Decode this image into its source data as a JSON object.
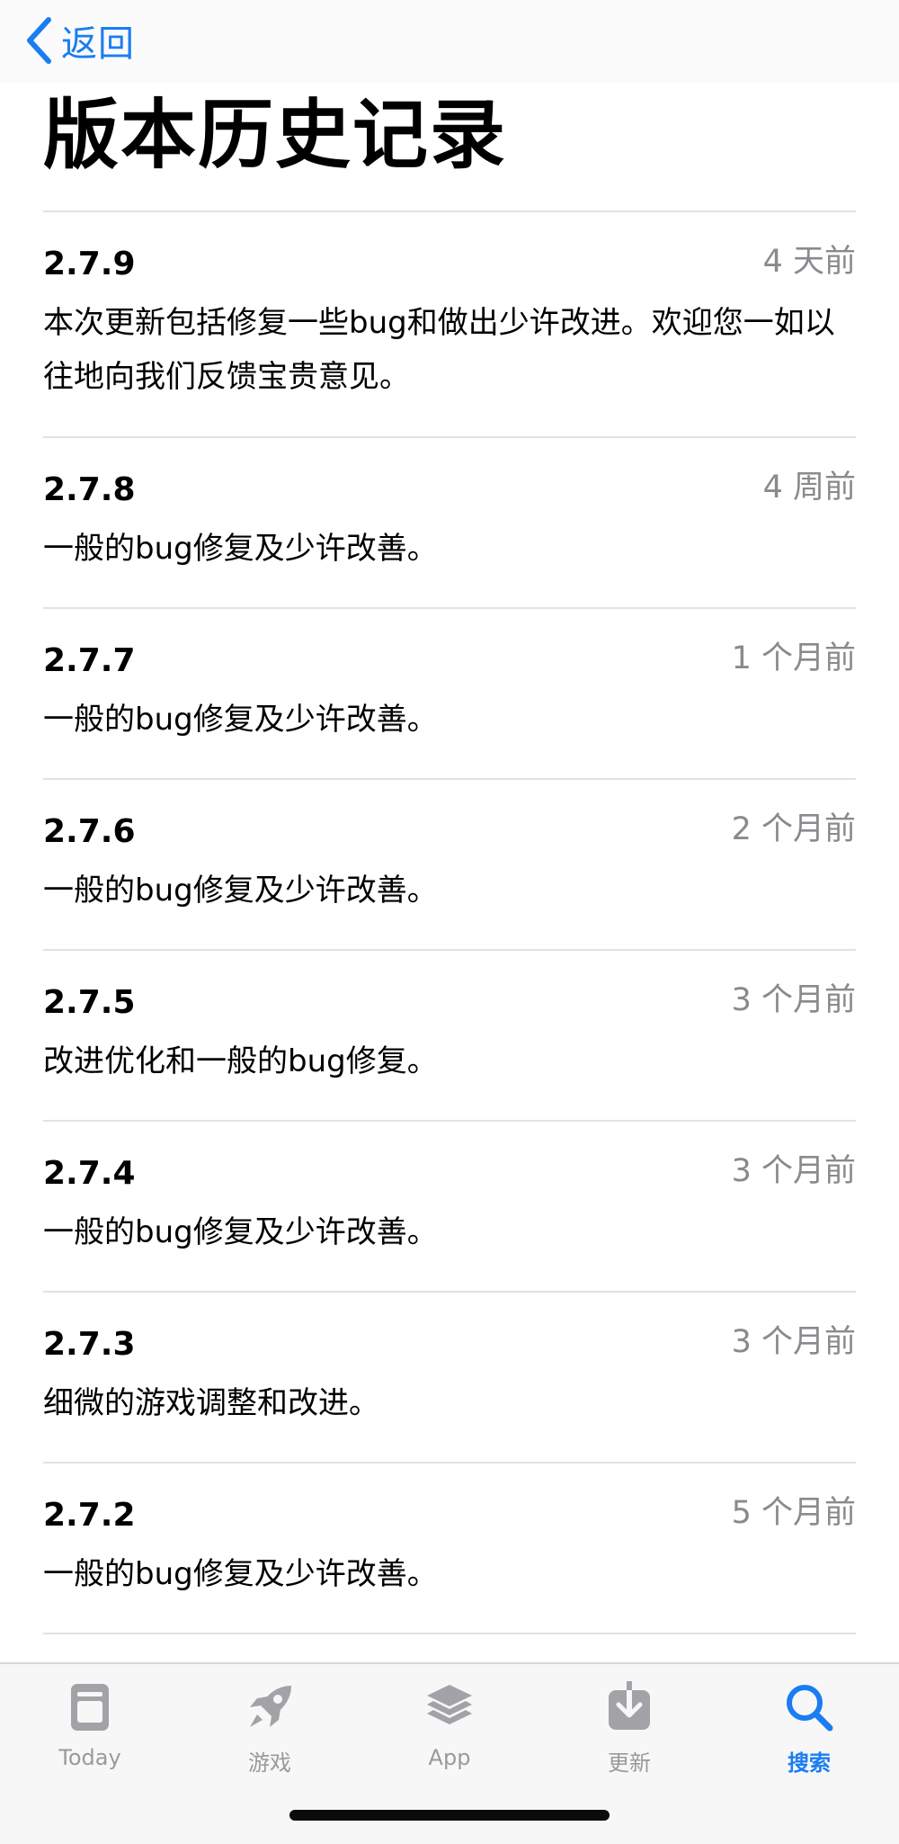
{
  "nav": {
    "back_label": "返回"
  },
  "page": {
    "title": "版本历史记录"
  },
  "versions": [
    {
      "number": "2.7.9",
      "date": "4 天前",
      "notes": "本次更新包括修复一些bug和做出少许改进。欢迎您一如以往地向我们反馈宝贵意见。"
    },
    {
      "number": "2.7.8",
      "date": "4 周前",
      "notes": "一般的bug修复及少许改善。"
    },
    {
      "number": "2.7.7",
      "date": "1 个月前",
      "notes": "一般的bug修复及少许改善。"
    },
    {
      "number": "2.7.6",
      "date": "2 个月前",
      "notes": "一般的bug修复及少许改善。"
    },
    {
      "number": "2.7.5",
      "date": "3 个月前",
      "notes": "改进优化和一般的bug修复。"
    },
    {
      "number": "2.7.4",
      "date": "3 个月前",
      "notes": "一般的bug修复及少许改善。"
    },
    {
      "number": "2.7.3",
      "date": "3 个月前",
      "notes": "细微的游戏调整和改进。"
    },
    {
      "number": "2.7.2",
      "date": "5 个月前",
      "notes": "一般的bug修复及少许改善。"
    }
  ],
  "tabbar": {
    "active": "search",
    "tabs": [
      {
        "id": "today",
        "label": "Today",
        "icon": "today-icon"
      },
      {
        "id": "games",
        "label": "游戏",
        "icon": "rocket-icon"
      },
      {
        "id": "apps",
        "label": "App",
        "icon": "layers-icon"
      },
      {
        "id": "updates",
        "label": "更新",
        "icon": "download-icon"
      },
      {
        "id": "search",
        "label": "搜索",
        "icon": "search-icon"
      }
    ]
  },
  "colors": {
    "accent": "#1a7df2",
    "secondary_text": "#8a8a8e",
    "divider": "#e2e2e4",
    "inactive_tab": "#9a9a9e"
  }
}
